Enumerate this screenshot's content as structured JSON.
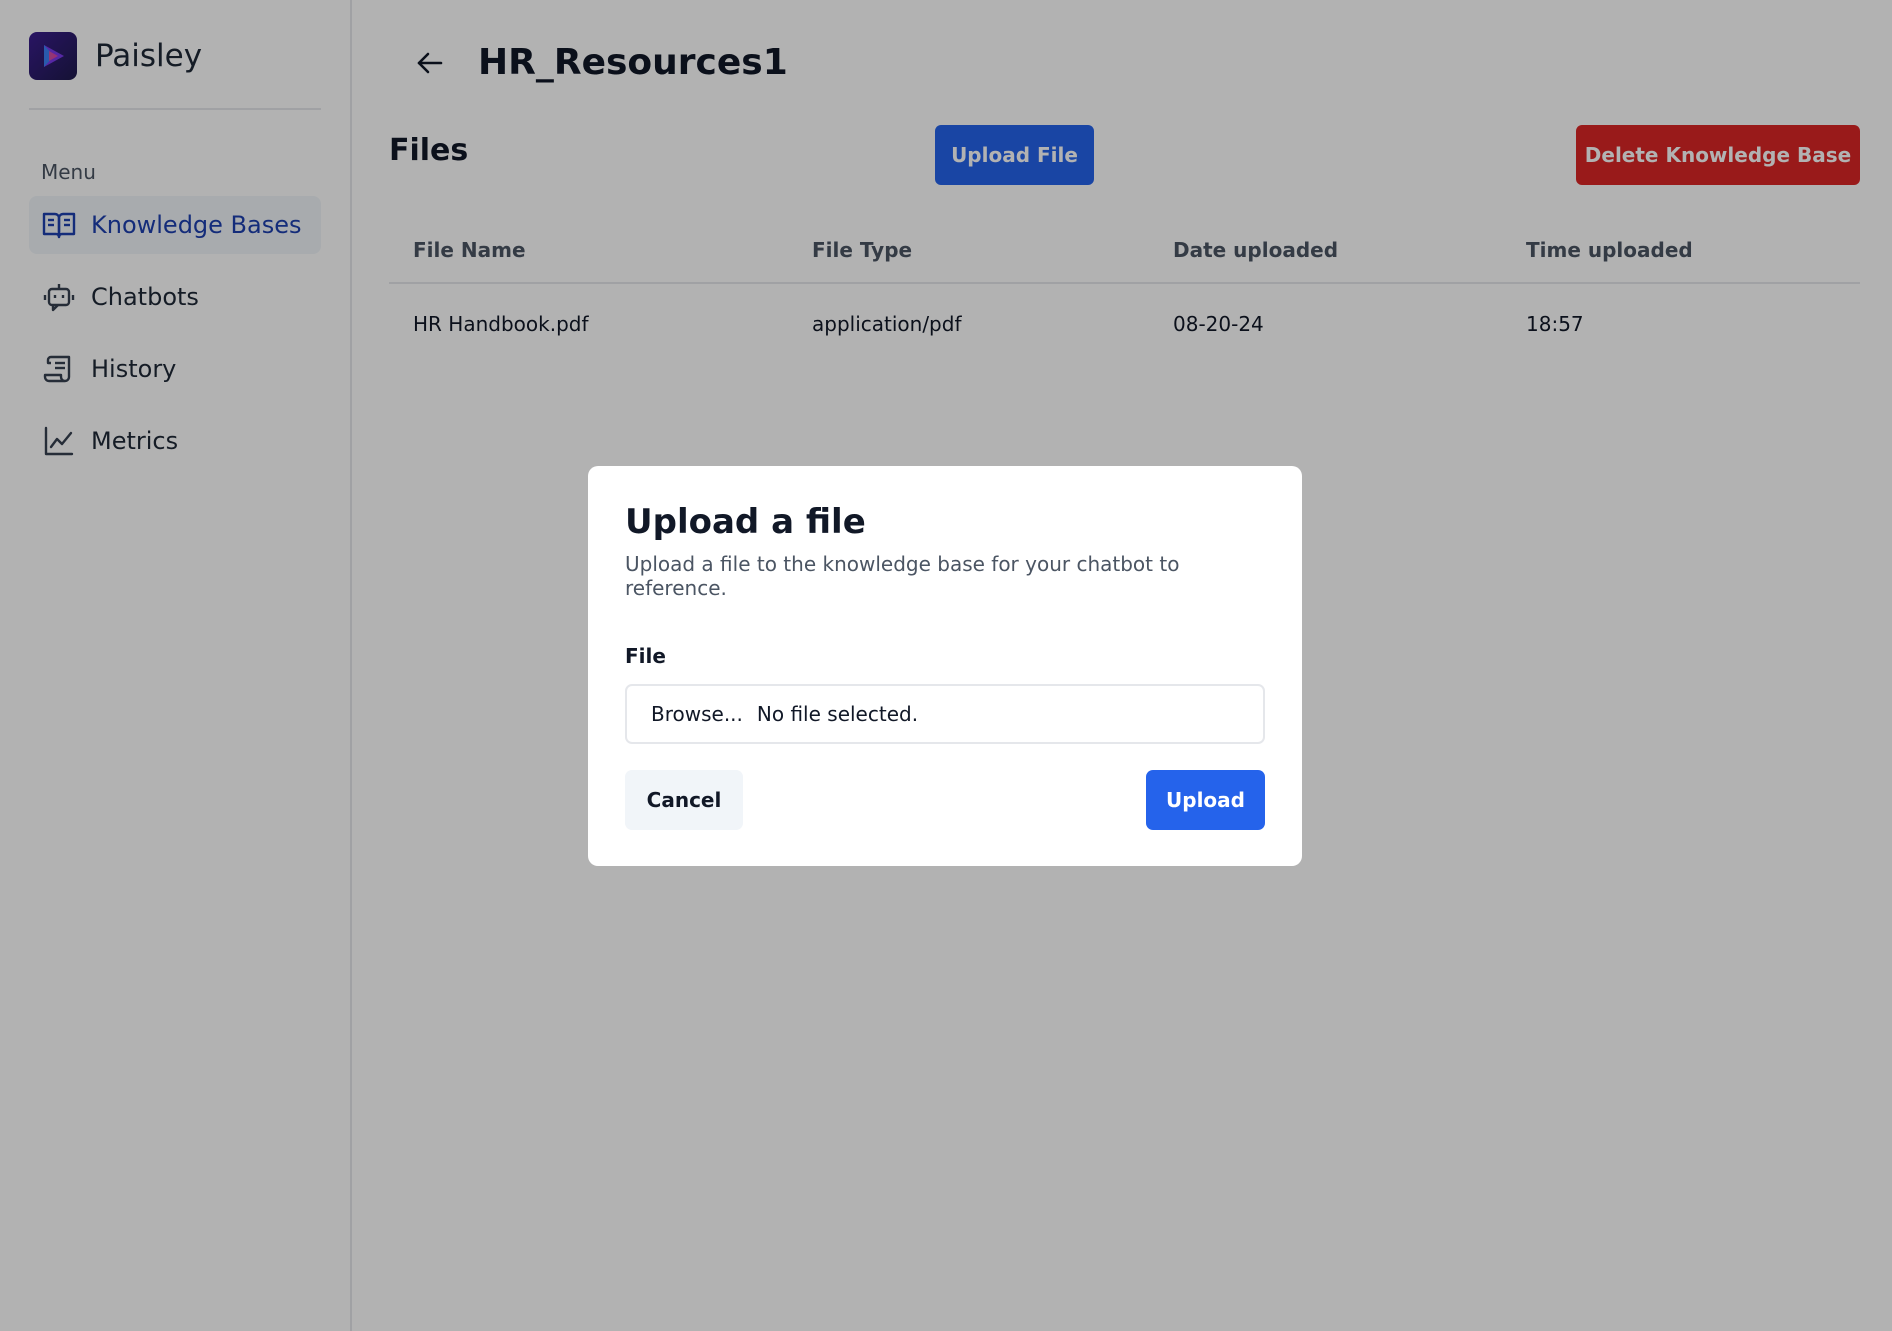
{
  "brand": {
    "name": "Paisley",
    "logo_icon": "paisley-logo-icon"
  },
  "sidebar": {
    "menu_label": "Menu",
    "items": [
      {
        "label": "Knowledge Bases",
        "icon": "book-open-icon",
        "active": true
      },
      {
        "label": "Chatbots",
        "icon": "robot-icon",
        "active": false
      },
      {
        "label": "History",
        "icon": "scroll-icon",
        "active": false
      },
      {
        "label": "Metrics",
        "icon": "line-chart-icon",
        "active": false
      }
    ]
  },
  "header": {
    "title": "HR_Resources1",
    "back_icon": "arrow-left-icon"
  },
  "files": {
    "title": "Files",
    "upload_button": "Upload File",
    "delete_button": "Delete Knowledge Base",
    "columns": [
      "File Name",
      "File Type",
      "Date uploaded",
      "Time uploaded"
    ],
    "rows": [
      [
        "HR Handbook.pdf",
        "application/pdf",
        "08-20-24",
        "18:57"
      ]
    ]
  },
  "dialog": {
    "title": "Upload a file",
    "description": "Upload a file to the knowledge base for your chatbot to reference.",
    "file_label": "File",
    "browse_label": "Browse...",
    "file_status": "No file selected.",
    "cancel_label": "Cancel",
    "upload_label": "Upload"
  },
  "colors": {
    "accent_blue": "#2563eb",
    "danger_red": "#dc2626",
    "active_nav_text": "#1e40af",
    "overlay": "rgba(0,0,0,0.30)"
  }
}
